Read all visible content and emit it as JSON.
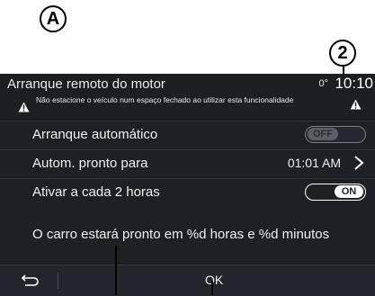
{
  "callouts": {
    "a": "A",
    "b": "2"
  },
  "header": {
    "title": "Arranque remoto do motor",
    "temperature": "0°",
    "clock": "10:10",
    "warning": "Não estacione o veículo num espaço fechado ao utilizar esta funcionalidade"
  },
  "rows": [
    {
      "label": "Arranque automático",
      "control": "toggle",
      "state": "OFF"
    },
    {
      "label": "Autom. pronto para",
      "control": "value",
      "value": "01:01 AM"
    },
    {
      "label": "Ativar a cada 2 horas",
      "control": "toggle",
      "state": "ON"
    }
  ],
  "info_text": "O carro estará pronto em %d horas e %d minutos",
  "footer": {
    "ok_label": "OK",
    "back_icon": "back-arrow-icon"
  },
  "colors": {
    "background": "#1d2126",
    "text": "#eef0f3",
    "toggle_on": "#ffffff",
    "toggle_off": "#5a5f66"
  }
}
